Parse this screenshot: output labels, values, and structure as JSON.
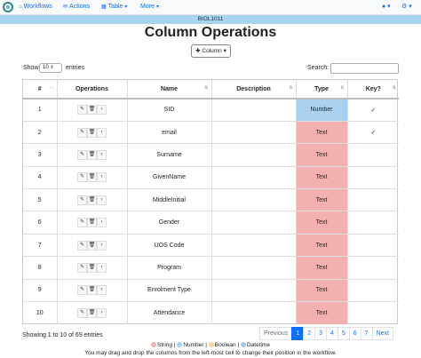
{
  "navbar": {
    "workflows": "Workflows",
    "actions": "Actions",
    "table": "Table",
    "more": "More",
    "user_icon": "user-icon",
    "settings_icon": "gear-icon"
  },
  "course": "BIOL1011",
  "title": "Column Operations",
  "column_button": "Column",
  "show_label": "Show",
  "entries_value": "10",
  "entries_label": "entries",
  "search_label": "Search:",
  "search_value": "",
  "headers": [
    "#",
    "Operations",
    "Name",
    "Description",
    "Type",
    "Key?"
  ],
  "rows": [
    {
      "num": "1",
      "name": "SID",
      "description": "",
      "type": "Number",
      "key": "✓",
      "kind": "number"
    },
    {
      "num": "2",
      "name": "email",
      "description": "",
      "type": "Text",
      "key": "✓",
      "kind": "string"
    },
    {
      "num": "3",
      "name": "Surname",
      "description": "",
      "type": "Text",
      "key": "",
      "kind": "string"
    },
    {
      "num": "4",
      "name": "GivenName",
      "description": "",
      "type": "Text",
      "key": "",
      "kind": "string"
    },
    {
      "num": "5",
      "name": "MiddleInitial",
      "description": "",
      "type": "Text",
      "key": "",
      "kind": "string"
    },
    {
      "num": "6",
      "name": "Gender",
      "description": "",
      "type": "Text",
      "key": "",
      "kind": "string"
    },
    {
      "num": "7",
      "name": "UOS Code",
      "description": "",
      "type": "Text",
      "key": "",
      "kind": "string"
    },
    {
      "num": "8",
      "name": "Program",
      "description": "",
      "type": "Text",
      "key": "",
      "kind": "string"
    },
    {
      "num": "9",
      "name": "Enrolment Type",
      "description": "",
      "type": "Text",
      "key": "",
      "kind": "string"
    },
    {
      "num": "10",
      "name": "Attendance",
      "description": "",
      "type": "Text",
      "key": "",
      "kind": "string"
    }
  ],
  "showing_info": "Showing 1 to 10 of 69 entries",
  "pagination": {
    "previous": "Previous",
    "pages": [
      "1",
      "2",
      "3",
      "4",
      "5",
      "6",
      "7"
    ],
    "active": "1",
    "next": "Next"
  },
  "legend": {
    "string": "String",
    "number": "Number",
    "boolean": "Boolean",
    "datetime": "Datetime",
    "sep": "|",
    "colors": {
      "string": "#f2b0b0",
      "number": "#a9d0ef",
      "boolean": "#f5d99a",
      "datetime": "#a8c7e8"
    }
  },
  "footer_note": "You may drag and drop the columns from the left-most cell to change their position in the workflow."
}
